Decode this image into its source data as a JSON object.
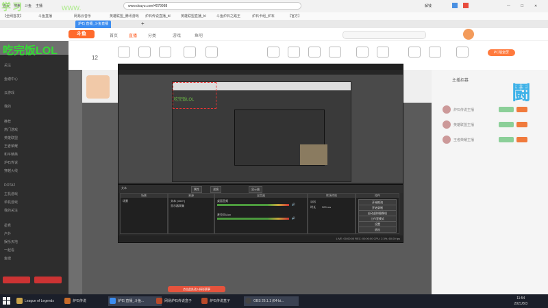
{
  "browser": {
    "url": "www.douyu.com/4079988",
    "tabs": [
      "炉石 直播_斗鱼直播"
    ],
    "bookmarks": [
      "【全网首发】",
      "斗鱼直播",
      "网易云音乐",
      "英雄联盟_腾讯游戏",
      "炉石传说直播_bl",
      "英雄联盟直播_bl",
      "斗鱼炉石之路王",
      "炉石卡组_炉石",
      "【官方】"
    ],
    "toolbar_items": [
      "首页",
      "搜索",
      "斗鱼",
      "主播"
    ],
    "right_label": "解钱"
  },
  "douyu": {
    "logo": "斗鱼",
    "nav": [
      "首页",
      "直播",
      "分类",
      "游戏",
      "鱼吧"
    ],
    "active_nav": "直播",
    "cat_count": "12",
    "recommend": "PC端全屏",
    "right_tab": "主播招募"
  },
  "overlay": {
    "title": "吃完饭LOL",
    "watermark_left": "学习",
    "watermark_mid": "www.",
    "brand": "鬪"
  },
  "sidebar": {
    "lines": [
      "关注",
      "鱼塘中心",
      "云游戏",
      "我的",
      "推荐",
      "热门游戏",
      "英雄联盟",
      "王者荣耀",
      "和平精英",
      "炉石传说",
      "穿越火线",
      "DOTA2",
      "主机游戏",
      "单机游戏",
      "我的关注",
      "星秀",
      "户外",
      "娱乐天地",
      "一起看",
      "鱼塘"
    ]
  },
  "obs": {
    "title": "OBS 26.1.1",
    "scene_label": "场景",
    "source_label": "来源",
    "mixer_label": "混音器",
    "transition_label": "转场特效",
    "controls_label": "控件",
    "scene_item": "场景",
    "source_items": [
      "文本 (GDI+)",
      "显示器采集"
    ],
    "mixer_items": [
      "桌面音频",
      "麦克风/Aux"
    ],
    "transition_value": "淡出",
    "duration_label": "时长",
    "duration_value": "300 ms",
    "controls": [
      "开始推流",
      "开始录制",
      "启动虚拟摄像机",
      "工作室模式",
      "设置",
      "退出"
    ],
    "toolbar_buttons": [
      "属性",
      "滤镜",
      "显示器"
    ],
    "status": "LIVE: 00:00:00   REC: 00:00:00   CPU: 2.3%, 60.00 fps",
    "preview_label": "文本"
  },
  "rightpanel": {
    "title": "主播招募",
    "rows": [
      "炉石传说主播",
      "英雄联盟主播",
      "王者荣耀主播"
    ]
  },
  "toast": "点击此处进入精彩赛事",
  "taskbar": {
    "items": [
      "League of Legends",
      "炉石传说",
      "炉石 直播_斗鱼...",
      "网易炉石传说盒子",
      "炉石传说盒子",
      "OBS 26.1.1 (64-bi..."
    ],
    "time": "11:54",
    "date": "2021/8/3"
  },
  "colors": {
    "accent": "#ff5d23",
    "overlay_green": "#33dd33",
    "taskbar": "#1b1f2a"
  }
}
